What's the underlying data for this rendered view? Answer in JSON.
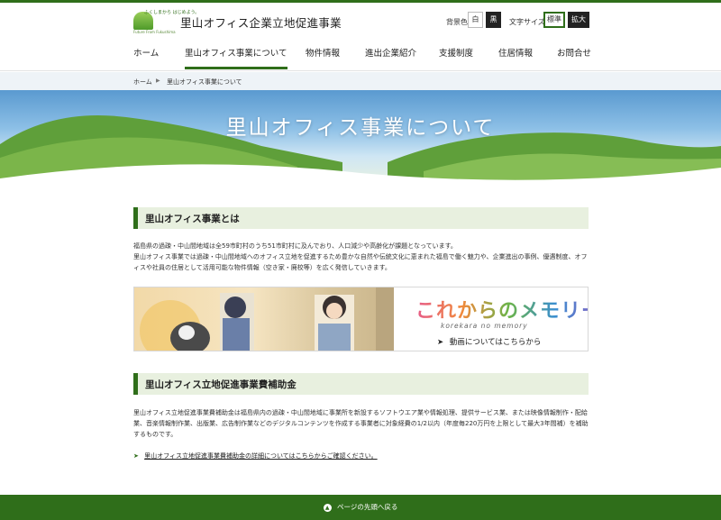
{
  "header": {
    "logo_tagline": "ふくしまから はじめよう。",
    "logo_sub": "Future From Fukushima",
    "site_title": "里山オフィス企業立地促進事業",
    "bg_color_label": "背景色",
    "bg_white": "白",
    "bg_black": "黒",
    "font_size_label": "文字サイズ",
    "font_standard": "標準",
    "font_large": "拡大"
  },
  "nav": {
    "items": [
      "ホーム",
      "里山オフィス事業について",
      "物件情報",
      "進出企業紹介",
      "支援制度",
      "住居情報",
      "お問合せ"
    ],
    "active_index": 1
  },
  "breadcrumb": {
    "home": "ホーム",
    "separator": "▶",
    "current": "里山オフィス事業について"
  },
  "hero": {
    "title": "里山オフィス事業について"
  },
  "section1": {
    "heading": "里山オフィス事業とは",
    "p1": "福島県の過疎・中山間地域は全59市町村のうち51市町村に及んでおり、人口減少や高齢化が課題となっています。",
    "p2": "里山オフィス事業では過疎・中山間地域へのオフィス立地を促進するため豊かな自然や伝統文化に恵まれた福島で働く魅力や、企業進出の事例、優遇制度、オフィスや社員の住居として活用可能な物件情報（空き家・廃校等）を広く発信していきます。"
  },
  "banner": {
    "title": "これからのメモリー",
    "subtitle": "korekara no memory",
    "link_arrow": "➤",
    "link_text": "動画についてはこちらから"
  },
  "section2": {
    "heading": "里山オフィス立地促進事業費補助金",
    "p1": "里山オフィス立地促進事業費補助金は福島県内の過疎・中山間地域に事業所を新設するソフトウエア業や情報処理、提供サービス業、または映像情報制作・配給業、音楽情報制作業、出版業、広告制作業などのデジタルコンテンツを作成する事業者に対象経費の1/2以内（年度毎220万円を上限として最大3年間補）を補助するものです。",
    "link_arrow": "➤",
    "link_text": "里山オフィス立地促進事業費補助金の詳細についてはこちらからご確認ください。"
  },
  "footer": {
    "back_to_top": "ページの先頭へ戻る",
    "back_icon": "▲"
  },
  "colors": {
    "brand_green": "#2f6e1a",
    "heading_bg": "#e8f0df",
    "breadcrumb_bg": "#eef3f7"
  }
}
